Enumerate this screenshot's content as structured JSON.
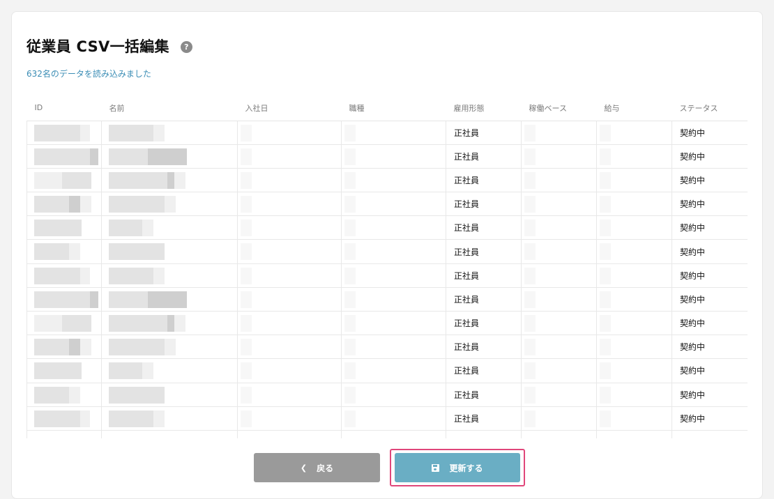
{
  "page": {
    "title": "従業員 CSV一括編集",
    "help_icon": "question-icon",
    "status_message": "632名のデータを読み込みました"
  },
  "table": {
    "columns": [
      "ID",
      "名前",
      "入社日",
      "職種",
      "雇用形態",
      "稼働ベース",
      "給与",
      "ステータス"
    ],
    "rows": [
      {
        "employment_type": "正社員",
        "status": "契約中"
      },
      {
        "employment_type": "正社員",
        "status": "契約中"
      },
      {
        "employment_type": "正社員",
        "status": "契約中"
      },
      {
        "employment_type": "正社員",
        "status": "契約中"
      },
      {
        "employment_type": "正社員",
        "status": "契約中"
      },
      {
        "employment_type": "正社員",
        "status": "契約中"
      },
      {
        "employment_type": "正社員",
        "status": "契約中"
      },
      {
        "employment_type": "正社員",
        "status": "契約中"
      },
      {
        "employment_type": "正社員",
        "status": "契約中"
      },
      {
        "employment_type": "正社員",
        "status": "契約中"
      },
      {
        "employment_type": "正社員",
        "status": "契約中"
      },
      {
        "employment_type": "正社員",
        "status": "契約中"
      },
      {
        "employment_type": "正社員",
        "status": "契約中"
      }
    ]
  },
  "actions": {
    "back_label": "戻る",
    "back_icon": "chevron-left-icon",
    "update_label": "更新する",
    "update_icon": "save-icon"
  },
  "colors": {
    "accent": "#6aaec4",
    "highlight": "#e0467a",
    "link": "#3b8db5"
  }
}
